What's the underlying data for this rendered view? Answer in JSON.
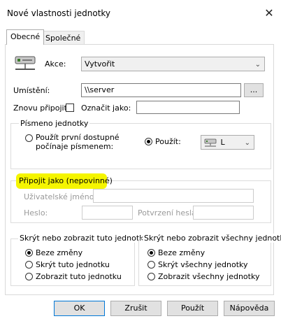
{
  "window": {
    "title": "Nové vlastnosti jednotky"
  },
  "tabs": [
    {
      "label": "Obecné"
    },
    {
      "label": "Společné"
    }
  ],
  "general": {
    "action_label": "Akce:",
    "action_value": "Vytvořit",
    "location_label": "Umístění:",
    "location_value": "\\\\server",
    "browse_label": "...",
    "reconnect_label": "Znovu připojit:",
    "tag_label": "Označit jako:",
    "tag_value": ""
  },
  "drive_letter": {
    "title": "Písmeno jednotky",
    "first_available_label": "Použít první dostupné počínaje písmenem:",
    "use_label": "Použít:",
    "letter_value": "L"
  },
  "connect_as": {
    "title": "Připojit jako (nepovinné)",
    "username_label": "Uživatelské jméno:",
    "username_value": "",
    "password_label": "Heslo:",
    "password_value": "",
    "confirm_label": "Potvrzení hesla:",
    "confirm_value": ""
  },
  "show_drive": {
    "title": "Skrýt nebo zobrazit tuto jednotku",
    "options": [
      "Beze změny",
      "Skrýt tuto jednotku",
      "Zobrazit tuto jednotku"
    ],
    "selected": "Beze změny"
  },
  "show_all": {
    "title": "Skrýt nebo zobrazit všechny jednotky",
    "options": [
      "Beze změny",
      "Skrýt všechny jednotky",
      "Zobrazit všechny jednotky"
    ],
    "selected": "Beze změny"
  },
  "buttons": {
    "ok": "OK",
    "cancel": "Zrušit",
    "apply": "Použít",
    "help": "Nápověda"
  },
  "colors": {
    "highlight": "#f5f500",
    "accent": "#0078d7"
  },
  "icons": {
    "drive": "network-drive-icon",
    "drive_small": "drive-icon",
    "close": "close-icon"
  }
}
